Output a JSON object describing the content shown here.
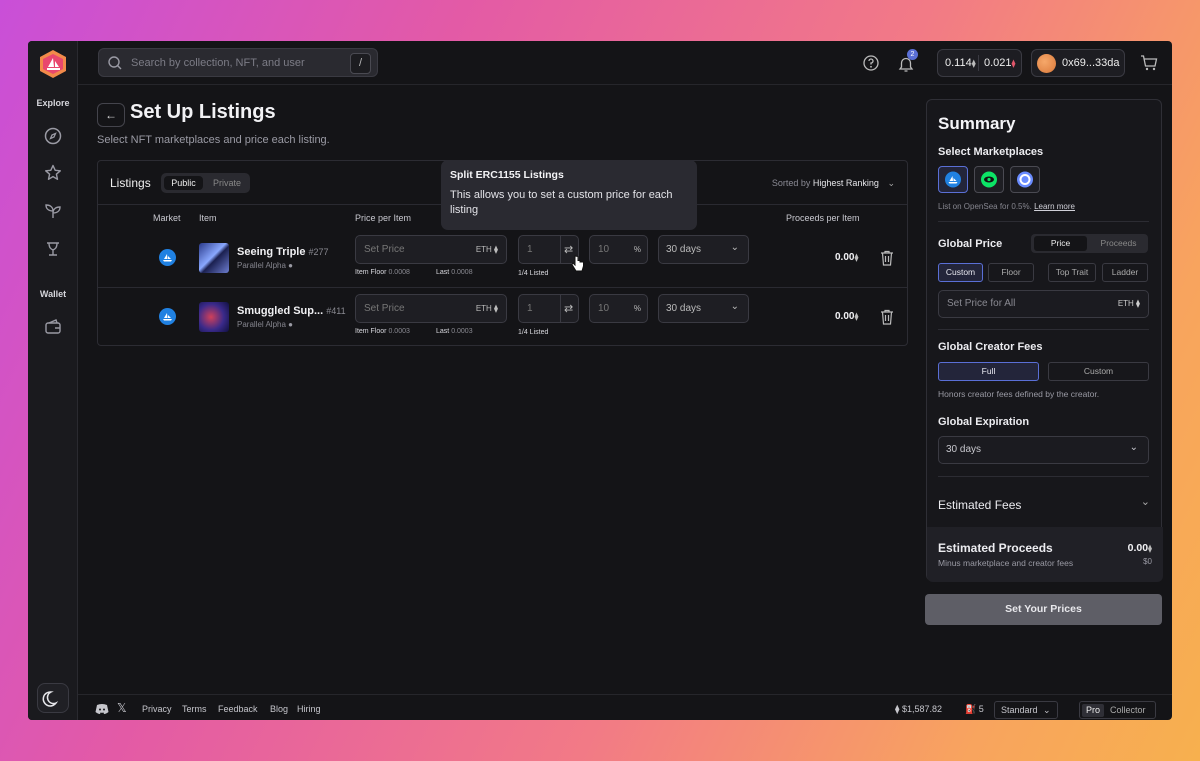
{
  "app": {
    "search_placeholder": "Search by collection, NFT, and user",
    "search_shortcut": "/"
  },
  "topbar": {
    "notifications_count": "2",
    "balance_a": "0.114",
    "balance_b": "0.021",
    "wallet_address": "0x69...33da",
    "eth_symbol": "⧫"
  },
  "sidebar": {
    "explore_label": "Explore",
    "wallet_label": "Wallet"
  },
  "page": {
    "title": "Set Up Listings",
    "subtitle": "Select NFT marketplaces and price each listing."
  },
  "listings": {
    "title": "Listings",
    "tab_public": "Public",
    "tab_private": "Private",
    "sorted_prefix": "Sorted by",
    "sorted_value": "Highest Ranking",
    "columns": {
      "market": "Market",
      "item": "Item",
      "price": "Price per Item",
      "proceeds": "Proceeds per Item",
      "expiration_suffix": "n"
    },
    "rows": [
      {
        "name": "Seeing Triple",
        "number": "#277",
        "collection": "Parallel Alpha",
        "price_placeholder": "Set Price",
        "currency": "ETH",
        "floor_label": "Item Floor",
        "floor_value": "0.0008",
        "last_label": "Last",
        "last_value": "0.0008",
        "qty": "1",
        "listed": "1/4 Listed",
        "pct": "10",
        "pct_symbol": "%",
        "expiration": "30 days",
        "proceeds": "0.00"
      },
      {
        "name": "Smuggled Sup...",
        "number": "#411",
        "collection": "Parallel Alpha",
        "price_placeholder": "Set Price",
        "currency": "ETH",
        "floor_label": "Item Floor",
        "floor_value": "0.0003",
        "last_label": "Last",
        "last_value": "0.0003",
        "qty": "1",
        "listed": "1/4 Listed",
        "pct": "10",
        "pct_symbol": "%",
        "expiration": "30 days",
        "proceeds": "0.00"
      }
    ]
  },
  "tooltip": {
    "title": "Split ERC1155 Listings",
    "body": "This allows you to set a custom price for each listing"
  },
  "summary": {
    "title": "Summary",
    "select_marketplaces": "Select Marketplaces",
    "opensea_note": "List on OpenSea for 0.5%.",
    "learn_more": "Learn more",
    "global_price": "Global Price",
    "toggle_price": "Price",
    "toggle_proceeds": "Proceeds",
    "price_options": [
      "Custom",
      "Floor",
      "Top Trait",
      "Ladder"
    ],
    "set_price_all": "Set Price for All",
    "currency": "ETH",
    "creator_fees_label": "Global Creator Fees",
    "fees_full": "Full",
    "fees_custom": "Custom",
    "fees_note": "Honors creator fees defined by the creator.",
    "expiration_label": "Global Expiration",
    "expiration_value": "30 days",
    "estimated_fees": "Estimated Fees",
    "estimated_proceeds": "Estimated Proceeds",
    "proceeds_note": "Minus marketplace and creator fees",
    "proceeds_value": "0.00",
    "proceeds_usd": "$0",
    "cta": "Set Your Prices"
  },
  "footer": {
    "links": [
      "Privacy",
      "Terms",
      "Feedback",
      "Blog",
      "Hiring"
    ],
    "eth_price": "$1,587.82",
    "gas": "5",
    "speed": "Standard",
    "mode_pro": "Pro",
    "mode_collector": "Collector"
  },
  "colors": {
    "accent": "#5a6fd6",
    "opensea_blue": "#2081e2",
    "background": "#141417"
  }
}
